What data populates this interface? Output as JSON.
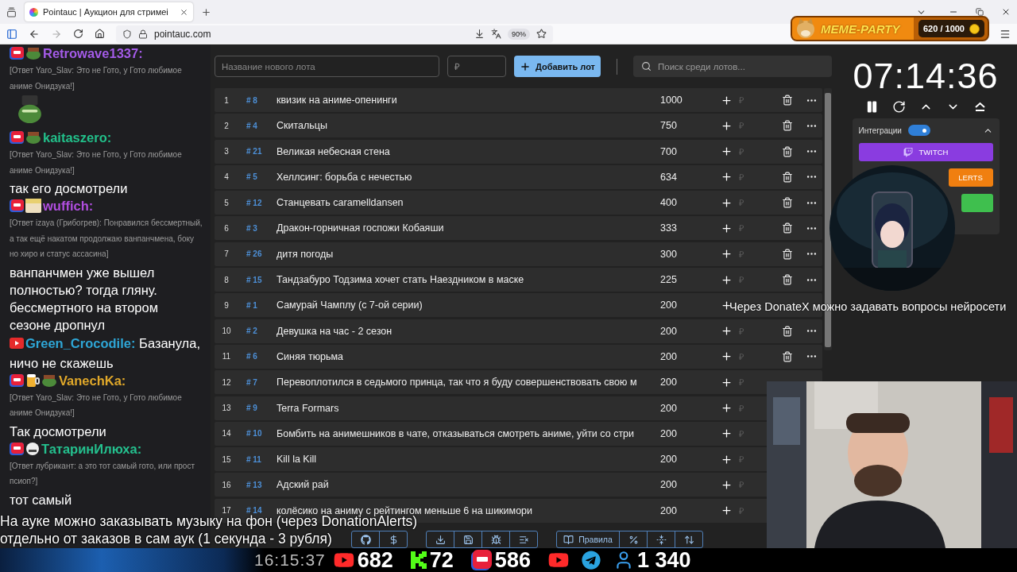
{
  "browser": {
    "tab_title": "Pointauc | Аукцион для стримеі",
    "url": "pointauc.com",
    "zoom": "90%"
  },
  "stream_badge": {
    "title": "MEME-PARTY",
    "progress": "620 / 1000",
    "level": 0.62
  },
  "chat": [
    {
      "badges": [
        {
          "kind": "live"
        },
        {
          "kind": "frog"
        }
      ],
      "user": "Retrowave1337:",
      "color": "#a45be8",
      "reply": "[Ответ Yaro_Slav: Это не Гото, у Гото любимое аниме Онидзука!]",
      "emote": {
        "kind": "frog"
      }
    },
    {
      "badges": [
        {
          "kind": "live"
        },
        {
          "kind": "frog"
        }
      ],
      "user": "kaitaszero:",
      "color": "#22c08a",
      "reply": "[Ответ Yaro_Slav: Это не Гото, у Гото любимое аниме Онидзука!]",
      "text": "так его досмотрели"
    },
    {
      "badges": [
        {
          "kind": "live"
        },
        {
          "kind": "anime"
        }
      ],
      "user": "wuffich:",
      "color": "#b14ee0",
      "reply": "[Ответ izaya (Грибогрев): Понравился бессмертный, а так ещё накатом продолжаю ванпанчмена, боку но хиро и статус ассасина]",
      "text": "ванпанчмен уже вышел полностью? тогда гляну. бессмертного на втором сезоне дропнул"
    },
    {
      "badges": [
        {
          "kind": "youtube"
        }
      ],
      "user": "Green_Crocodile:",
      "color": "#2ea6d6",
      "inline": [
        "Базанула,",
        "ничо не скажешь"
      ]
    },
    {
      "badges": [
        {
          "kind": "live"
        },
        {
          "kind": "beer"
        },
        {
          "kind": "frog"
        }
      ],
      "user": "VanechKa:",
      "color": "#e0a82a",
      "reply": "[Ответ Yaro_Slav: Это не Гото, у Гото любимое аниме Онидзука!]",
      "text": "Так досмотрели"
    },
    {
      "badges": [
        {
          "kind": "live"
        },
        {
          "kind": "face"
        }
      ],
      "user": "ТатаринИлюха:",
      "color": "#24c08e",
      "reply": "[Ответ лубрикант: а это тот самый гото, или прост псиоп?]",
      "text": "тот самый"
    }
  ],
  "toolbar": {
    "name_placeholder": "Название нового лота",
    "price_placeholder": "₽",
    "add_button": "Добавить лот",
    "search_placeholder": "Поиск среди лотов..."
  },
  "lots": [
    {
      "rank": "1",
      "id": "# 8",
      "name": "квизик на аниме-опенинги",
      "amount": "1000",
      "price_placeholder": "₽",
      "actions_shown": true
    },
    {
      "rank": "2",
      "id": "# 4",
      "name": "Скитальцы",
      "amount": "750",
      "price_placeholder": "₽",
      "actions_shown": true
    },
    {
      "rank": "3",
      "id": "# 21",
      "name": "Великая небесная стена",
      "amount": "700",
      "price_placeholder": "₽",
      "actions_shown": true
    },
    {
      "rank": "4",
      "id": "# 5",
      "name": "Хеллсинг: борьба с нечестью",
      "amount": "634",
      "price_placeholder": "₽",
      "actions_shown": true
    },
    {
      "rank": "5",
      "id": "# 12",
      "name": "Станцевать caramelldansen",
      "amount": "400",
      "price_placeholder": "₽",
      "actions_shown": true
    },
    {
      "rank": "6",
      "id": "# 3",
      "name": "Дракон-горничная госпожи Кобаяши",
      "amount": "333",
      "price_placeholder": "₽",
      "actions_shown": true
    },
    {
      "rank": "7",
      "id": "# 26",
      "name": "дитя погоды",
      "amount": "300",
      "price_placeholder": "₽",
      "actions_shown": true
    },
    {
      "rank": "8",
      "id": "# 15",
      "name": "Тандзабуро Тодзима хочет стать Наездником в маске",
      "amount": "225",
      "price_placeholder": "₽",
      "actions_shown": true
    },
    {
      "rank": "9",
      "id": "# 1",
      "name": "Самурай Чамплу (с 7-ой серии)",
      "amount": "200",
      "actions_shown": false
    },
    {
      "rank": "10",
      "id": "# 2",
      "name": "Девушка на час - 2 сезон",
      "amount": "200",
      "price_placeholder": "₽",
      "actions_shown": true
    },
    {
      "rank": "11",
      "id": "# 6",
      "name": "Синяя тюрьма",
      "amount": "200",
      "price_placeholder": "₽",
      "actions_shown": true
    },
    {
      "rank": "12",
      "id": "# 7",
      "name": "Перевоплотился в седьмого принца, так что я буду совершенствовать свою м",
      "amount": "200",
      "price_placeholder": "₽",
      "actions_shown": false
    },
    {
      "rank": "13",
      "id": "# 9",
      "name": "Terra Formars",
      "amount": "200",
      "price_placeholder": "₽",
      "actions_shown": false
    },
    {
      "rank": "14",
      "id": "# 10",
      "name": "Бомбить на анимешников в чате, отказываться смотреть аниме, уйти со стри",
      "amount": "200",
      "price_placeholder": "₽",
      "actions_shown": false
    },
    {
      "rank": "15",
      "id": "# 11",
      "name": "Kill la Kill",
      "amount": "200",
      "price_placeholder": "₽",
      "actions_shown": false
    },
    {
      "rank": "16",
      "id": "# 13",
      "name": "Адский рай",
      "amount": "200",
      "price_placeholder": "₽",
      "actions_shown": false
    },
    {
      "rank": "17",
      "id": "# 14",
      "name": "колёсико на аниму с рейтингом меньше 6 на шикимори",
      "amount": "200",
      "price_placeholder": "₽",
      "actions_shown": false
    }
  ],
  "bottom_toolbar": [
    [
      {
        "kind": "github"
      },
      {
        "kind": "donate"
      }
    ],
    [
      {
        "kind": "download"
      },
      {
        "kind": "save"
      },
      {
        "kind": "bug"
      },
      {
        "kind": "clear"
      }
    ],
    [
      {
        "kind": "rules",
        "label": "Правила"
      },
      {
        "kind": "percent"
      },
      {
        "kind": "split"
      },
      {
        "kind": "sort"
      }
    ]
  ],
  "timer": {
    "time": "07:14:36"
  },
  "integrations": {
    "label": "Интеграции",
    "on": true,
    "expanded": true,
    "buttons": [
      {
        "kind": "twitch",
        "label": "TWITCH"
      },
      {
        "kind": "donationalerts",
        "label": "LERTS"
      },
      {
        "kind": "donatex"
      }
    ]
  },
  "subtitles": [
    "На ауке можно заказывать музыку на фон (через DonationAlerts)",
    "отдельно от заказов в сам аук (1 секунда - 3 рубля)"
  ],
  "side_subtitle": "Через DonateX можно задавать вопросы нейросети",
  "stream_stats": {
    "clock": "16:15:37",
    "items": [
      {
        "kind": "youtube",
        "value": "682"
      },
      {
        "kind": "kick",
        "value": "72"
      },
      {
        "kind": "live",
        "value": "586"
      },
      {
        "kind": "youtube"
      },
      {
        "kind": "telegram"
      },
      {
        "kind": "viewers",
        "value": "1 340"
      }
    ]
  }
}
